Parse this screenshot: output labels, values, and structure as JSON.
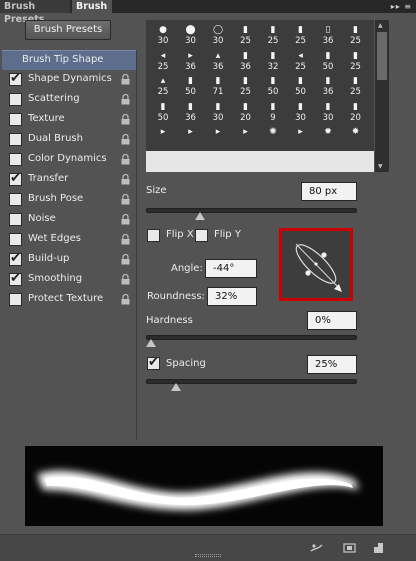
{
  "tabs": {
    "presets": "Brush Presets",
    "brush": "Brush",
    "controls": "▸▸ ≡"
  },
  "presets_button": "Brush Presets",
  "options": [
    {
      "label": "Brush Tip Shape",
      "header": true,
      "checkbox": false,
      "checked": false,
      "lock": false
    },
    {
      "label": "Shape Dynamics",
      "header": false,
      "checkbox": true,
      "checked": true,
      "lock": true
    },
    {
      "label": "Scattering",
      "header": false,
      "checkbox": true,
      "checked": false,
      "lock": true
    },
    {
      "label": "Texture",
      "header": false,
      "checkbox": true,
      "checked": false,
      "lock": true
    },
    {
      "label": "Dual Brush",
      "header": false,
      "checkbox": true,
      "checked": false,
      "lock": true
    },
    {
      "label": "Color Dynamics",
      "header": false,
      "checkbox": true,
      "checked": false,
      "lock": true
    },
    {
      "label": "Transfer",
      "header": false,
      "checkbox": true,
      "checked": true,
      "lock": true
    },
    {
      "label": "Brush Pose",
      "header": false,
      "checkbox": true,
      "checked": false,
      "lock": true
    },
    {
      "label": "Noise",
      "header": false,
      "checkbox": true,
      "checked": false,
      "lock": true
    },
    {
      "label": "Wet Edges",
      "header": false,
      "checkbox": true,
      "checked": false,
      "lock": true
    },
    {
      "label": "Build-up",
      "header": false,
      "checkbox": true,
      "checked": true,
      "lock": true
    },
    {
      "label": "Smoothing",
      "header": false,
      "checkbox": true,
      "checked": true,
      "lock": true
    },
    {
      "label": "Protect Texture",
      "header": false,
      "checkbox": true,
      "checked": false,
      "lock": true
    }
  ],
  "brush_sizes": [
    [
      "30",
      "30",
      "30",
      "25",
      "25",
      "25",
      "36",
      "25"
    ],
    [
      "25",
      "36",
      "36",
      "36",
      "32",
      "25",
      "50",
      "25"
    ],
    [
      "25",
      "50",
      "71",
      "25",
      "50",
      "50",
      "36",
      "25"
    ],
    [
      "50",
      "36",
      "30",
      "20",
      "9",
      "30",
      "30",
      "20"
    ],
    [
      "",
      "",
      "",
      "",
      "",
      "",
      "",
      ""
    ]
  ],
  "size": {
    "label": "Size",
    "value": "80 px",
    "fraction": 0.24
  },
  "flip_x": {
    "label": "Flip X",
    "checked": false
  },
  "flip_y": {
    "label": "Flip Y",
    "checked": false
  },
  "angle": {
    "label": "Angle:",
    "value": "-44°"
  },
  "roundness": {
    "label": "Roundness:",
    "value": "32%"
  },
  "hardness": {
    "label": "Hardness",
    "value": "0%",
    "fraction": 0.0
  },
  "spacing": {
    "label": "Spacing",
    "value": "25%",
    "checked": true,
    "fraction": 0.12
  },
  "colors": {
    "panel": "#535353",
    "header": "#5d6e8d",
    "highlight": "#cc0000"
  },
  "icons": [
    "brush-pressure-icon",
    "create-preset-icon",
    "new-brush-icon"
  ]
}
